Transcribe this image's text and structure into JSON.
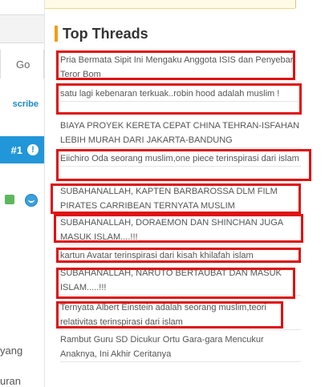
{
  "left": {
    "go_label": "Go",
    "subscribe_label": "scribe",
    "rank_label": "#1",
    "rank_alert": "!",
    "partial_texts": [
      "yang",
      "uran"
    ]
  },
  "panel": {
    "title": "Top Threads",
    "threads": [
      {
        "text": "Pria Bermata Sipit Ini Mengaku Anggota ISIS dan Penyebar Teror Bom",
        "highlighted": true
      },
      {
        "text": "satu lagi kebenaran terkuak..robin hood adalah muslim !",
        "highlighted": true
      },
      {
        "text": "BIAYA PROYEK KERETA CEPAT CHINA TEHRAN-ISFAHAN LEBIH MURAH DARI JAKARTA-BANDUNG",
        "highlighted": false
      },
      {
        "text": "Eiichiro Oda seorang muslim,one piece terinspirasi dari islam",
        "highlighted": true
      },
      {
        "text": "SUBAHANALLAH, KAPTEN BARBAROSSA DLM FILM PIRATES CARRIBEAN TERNYATA MUSLIM",
        "highlighted": true
      },
      {
        "text": "SUBAHANALLAH, DORAEMON DAN SHINCHAN JUGA MASUK ISLAM....!!!",
        "highlighted": true
      },
      {
        "text": "kartun Avatar terinspirasi dari kisah khilafah islam",
        "highlighted": true
      },
      {
        "text": "SUBAHANALLAH, NARUTO BERTAUBAT DAN MASUK ISLAM.....!!!",
        "highlighted": true
      },
      {
        "text": "Ternyata Albert Einstein adalah seorang muslim,teori relativitas terinspirasi dari islam",
        "highlighted": true
      },
      {
        "text": "Rambut Guru SD Dicukur Ortu Gara-gara Mencukur Anaknya, Ini Akhir Ceritanya",
        "highlighted": false
      }
    ]
  },
  "colors": {
    "accent_orange": "#f39c12",
    "highlight_red": "#e01010",
    "rank_blue": "#2196d8",
    "link_blue": "#1e88c7"
  }
}
